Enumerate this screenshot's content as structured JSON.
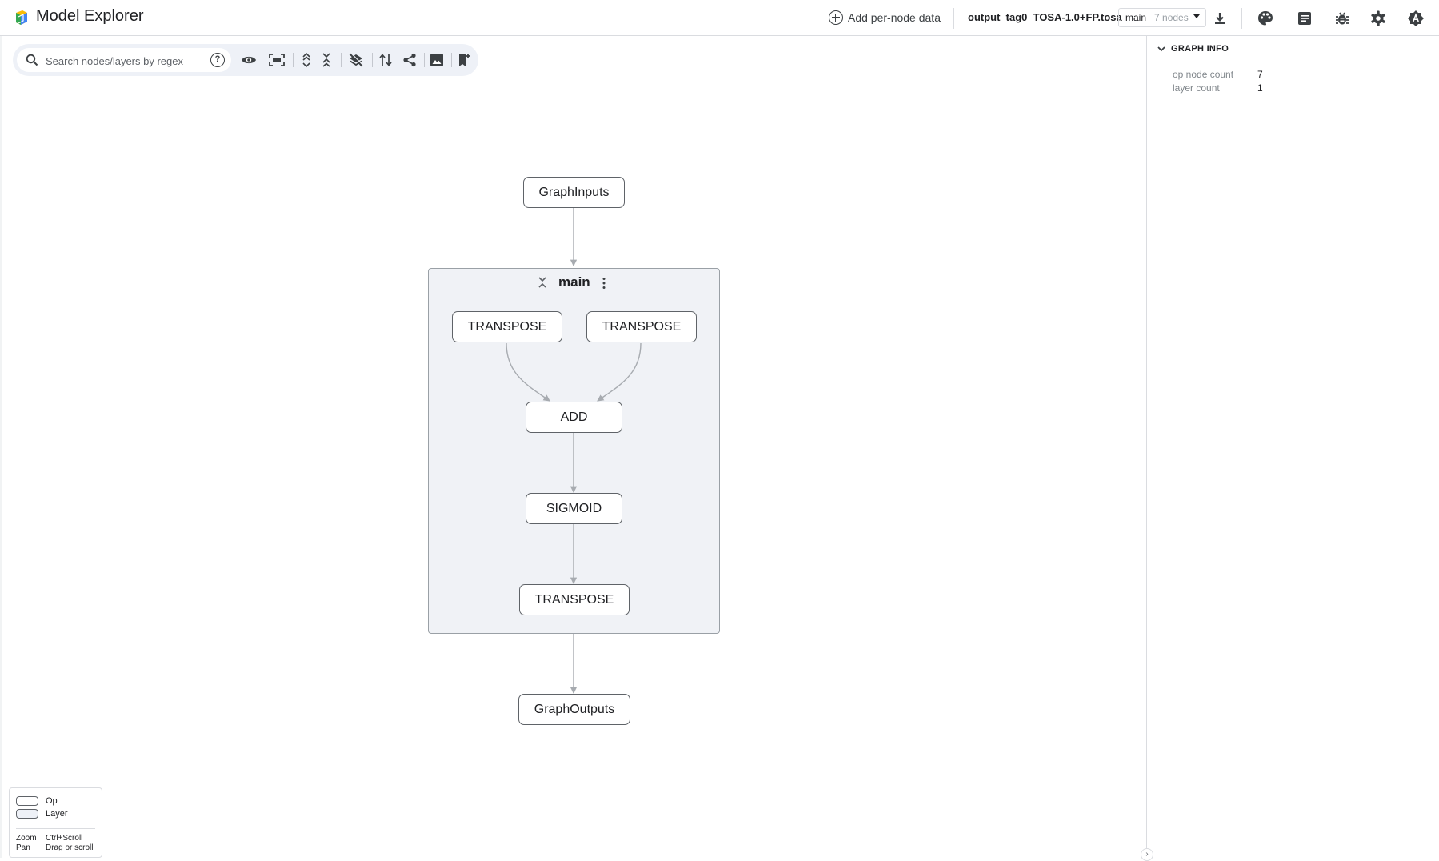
{
  "app": {
    "title": "Model Explorer"
  },
  "header": {
    "add_data_label": "Add per-node data",
    "model_name": "output_tag0_TOSA-1.0+FP.tosa",
    "graph_selector": {
      "selected": "main",
      "count": "7 nodes"
    }
  },
  "search": {
    "placeholder": "Search nodes/layers by regex",
    "help": "?"
  },
  "graph": {
    "inputs_label": "GraphInputs",
    "outputs_label": "GraphOutputs",
    "layer": {
      "name": "main",
      "nodes": [
        {
          "label": "TRANSPOSE"
        },
        {
          "label": "TRANSPOSE"
        },
        {
          "label": "ADD"
        },
        {
          "label": "SIGMOID"
        },
        {
          "label": "TRANSPOSE"
        }
      ]
    }
  },
  "legend": {
    "op_label": "Op",
    "layer_label": "Layer",
    "zoom_key": "Zoom",
    "zoom_value": "Ctrl+Scroll",
    "pan_key": "Pan",
    "pan_value": "Drag or scroll"
  },
  "side_panel": {
    "section_title": "GRAPH INFO",
    "rows": [
      {
        "key": "op node count",
        "value": "7"
      },
      {
        "key": "layer count",
        "value": "1"
      }
    ],
    "expand_glyph": "›"
  },
  "colors": {
    "accent": "#1a73e8",
    "layer_fill": "#f0f2f6",
    "node_border": "#5f6368",
    "edge": "#9aa0a6"
  }
}
